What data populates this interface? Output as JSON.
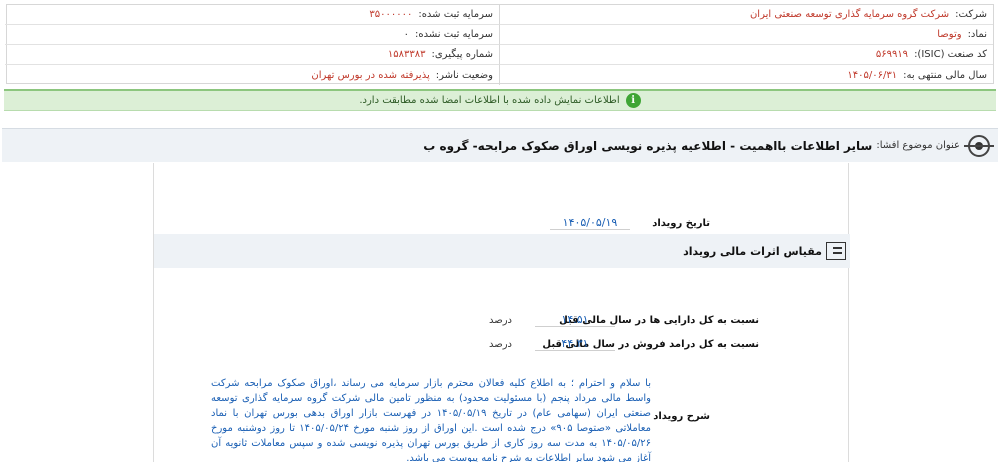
{
  "company": {
    "company_label": "شرکت:",
    "company_value": "شرکت گروه سرمایه گذاری توسعه صنعتی ایران",
    "capital_registered_label": "سرمایه ثبت شده:",
    "capital_registered_value": "۳۵۰۰۰۰۰۰",
    "symbol_label": "نماد:",
    "symbol_value": "وتوصا",
    "capital_unregistered_label": "سرمایه ثبت نشده:",
    "capital_unregistered_value": "۰",
    "isic_label": "کد صنعت (ISIC):",
    "isic_value": "۵۶۹۹۱۹",
    "tracking_label": "شماره پیگیری:",
    "tracking_value": "۱۵۸۳۳۸۳",
    "fiscal_label": "سال مالی منتهی به:",
    "fiscal_value": "۱۴۰۵/۰۶/۳۱",
    "status_label": "وضعیت ناشر:",
    "status_value": "پذیرفته شده در بورس تهران"
  },
  "notice": {
    "icon": "info-icon",
    "text": "اطلاعات نمایش داده شده با اطلاعات امضا شده مطابقت دارد."
  },
  "subject": {
    "label": "عنوان موضوع افشا:",
    "title": "سایر اطلاعات بااهمیت - اطلاعیه پذیره نویسی اوراق صکوک مرابحه- گروه ب"
  },
  "event": {
    "date_label": "تاریخ رویداد",
    "date_value": "۱۴۰۵/۰۵/۱۹",
    "section_title": "مقیاس اثرات مالی رویداد",
    "metrics": [
      {
        "label": "نسبت به کل دارایی ها در سال مالی قبل",
        "value": "۱۴.۵۱",
        "unit": "درصد"
      },
      {
        "label": "نسبت به کل درامد فروش در سال مالی قبل",
        "value": "۴۴.۳۱",
        "unit": "درصد"
      }
    ],
    "description_label": "شرح رویداد",
    "description": "با سلام و احترام ؛ به اطلاع کلیه فعالان محترم بازار سرمایه می رساند ،اوراق صکوک مرابحه شرکت واسط مالی مرداد پنجم (با مسئولیت محدود) به منظور تامین مالی شرکت گروه سرمایه گذاری توسعه صنعتی ایران (سهامی عام) در تاریخ ۱۴۰۵/۰۵/۱۹ در فهرست بازار اوراق بدهی بورس تهران با نماد معاملاتی «صتوصا ۹۰۵» درج شده است .این اوراق از روز شنبه مورخ ۱۴۰۵/۰۵/۲۴ تا روز دوشنبه مورخ ۱۴۰۵/۰۵/۲۶ به مدت سه روز کاری از طریق بورس تهران پذیره نویسی شده و سپس معاملات ثانویه آن آغاز می شود سایر اطلاعات به شرح نامه پیوست می باشد."
  }
}
